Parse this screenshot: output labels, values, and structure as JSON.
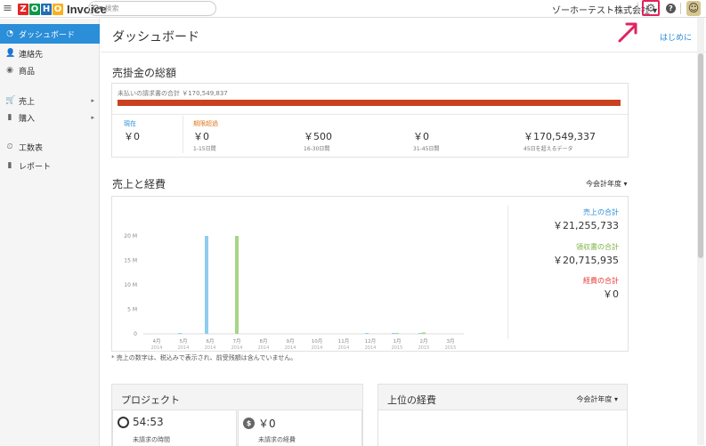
{
  "topbar": {
    "logo_letters": [
      "Z",
      "O",
      "H",
      "O"
    ],
    "app_name": "Invoice",
    "search_placeholder": "検索",
    "org_name": "ゾーホーテスト株式会社",
    "colors": {
      "zoho_letters": [
        "#e42527",
        "#089949",
        "#226db4",
        "#f9b21d"
      ],
      "highlight": "#e0245e"
    },
    "icons": [
      "menu-icon",
      "search-icon",
      "gear-icon",
      "help-icon",
      "avatar"
    ]
  },
  "sidebar": {
    "items": [
      {
        "label": "ダッシュボード",
        "icon": "dashboard-icon",
        "active": true
      },
      {
        "label": "連絡先",
        "icon": "contacts-icon"
      },
      {
        "label": "商品",
        "icon": "items-icon"
      },
      {
        "label": "売上",
        "icon": "sales-icon",
        "has_submenu": true
      },
      {
        "label": "購入",
        "icon": "purchases-icon",
        "has_submenu": true
      },
      {
        "label": "工数表",
        "icon": "timesheet-icon"
      },
      {
        "label": "レポート",
        "icon": "reports-icon"
      }
    ],
    "accent": "#2a8ed9"
  },
  "main": {
    "title": "ダッシュボード",
    "start_link": "はじめに"
  },
  "receivables": {
    "title": "売掛金の総額",
    "unpaid_total": "未払いの請求書の合計 ￥170,549,837",
    "bar_color": "#c9411f",
    "current": {
      "label": "現在",
      "amount": "￥0"
    },
    "overdue_label": "期限超過",
    "buckets": [
      {
        "amount": "￥0",
        "range": "1-15日間"
      },
      {
        "amount": "￥500",
        "range": "16-30日間"
      },
      {
        "amount": "￥0",
        "range": "31-45日間"
      },
      {
        "amount": "￥170,549,337",
        "range": "45日を超えるデータ"
      }
    ]
  },
  "sales_expenses": {
    "title": "売上と経費",
    "period": "今会計年度",
    "totals": [
      {
        "label": "売上の合計",
        "amount": "￥21,255,733",
        "color": "#2a8ed9"
      },
      {
        "label": "領収書の合計",
        "amount": "￥20,715,935",
        "color": "#7cb342"
      },
      {
        "label": "経費の合計",
        "amount": "￥0",
        "color": "#e53935"
      }
    ],
    "footnote": "* 売上の数字は、税込みで表示され、前受残額は含んでいません。"
  },
  "chart_data": {
    "type": "bar",
    "categories": [
      "4月 2014",
      "5月 2014",
      "6月 2014",
      "7月 2014",
      "8月 2014",
      "9月 2014",
      "10月 2014",
      "11月 2014",
      "12月 2014",
      "1月 2015",
      "2月 2015",
      "3月 2015"
    ],
    "category_labels": [
      [
        "4月",
        "2014"
      ],
      [
        "5月",
        "2014"
      ],
      [
        "6月",
        "2014"
      ],
      [
        "7月",
        "2014"
      ],
      [
        "8月",
        "2014"
      ],
      [
        "9月",
        "2014"
      ],
      [
        "10月",
        "2014"
      ],
      [
        "11月",
        "2014"
      ],
      [
        "12月",
        "2014"
      ],
      [
        "1月",
        "2015"
      ],
      [
        "2月",
        "2015"
      ],
      [
        "3月",
        "2015"
      ]
    ],
    "y_ticks": [
      "0",
      "5 M",
      "10 M",
      "15 M",
      "20 M"
    ],
    "ylim": [
      0,
      20000000
    ],
    "series": [
      {
        "color": "#8ecdf0",
        "values": [
          0,
          100000,
          20000000,
          0,
          0,
          0,
          0,
          0,
          50000,
          100000,
          100000,
          0
        ]
      },
      {
        "color": "#a8d585",
        "values": [
          0,
          0,
          0,
          20000000,
          0,
          0,
          0,
          0,
          0,
          50000,
          300000,
          0
        ]
      },
      {
        "color": "#e57373",
        "values": [
          0,
          0,
          0,
          0,
          0,
          0,
          0,
          0,
          0,
          0,
          0,
          0
        ]
      }
    ],
    "grid": false
  },
  "projects": {
    "title": "プロジェクト",
    "unbilled_hours": {
      "value": "54:53",
      "label": "未請求の時間"
    },
    "unbilled_expenses": {
      "value": "￥0",
      "label": "未請求の経費"
    }
  },
  "top_expenses": {
    "title": "上位の経費",
    "period": "今会計年度"
  }
}
